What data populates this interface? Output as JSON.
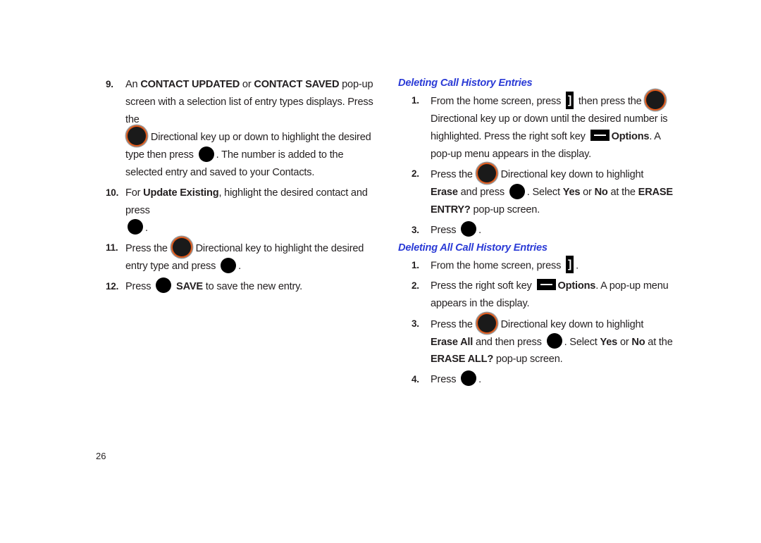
{
  "page_number": "26",
  "icons": {
    "directional_key": "directional-key-icon",
    "ok_key": "ok-key-icon",
    "end_key": "end-key-icon",
    "right_soft_key": "right-soft-key-icon"
  },
  "colors": {
    "heading": "#2b3bd6",
    "dpad_ring": "#e05a1c",
    "text": "#231f20"
  },
  "left_steps": [
    {
      "num": "9.",
      "t1": "An ",
      "b1": "CONTACT UPDATED",
      "t2": " or ",
      "b2": "CONTACT SAVED",
      "t3": " pop-up screen with a selection list of entry types displays. Press the",
      "t4": " Directional key up or down to highlight the desired type then press",
      "t5": ". The number is added to the selected entry and saved to your Contacts."
    },
    {
      "num": "10.",
      "t1": "For ",
      "b1": "Update Existing",
      "t2": ", highlight the desired contact and press",
      "t3": "."
    },
    {
      "num": "11.",
      "t1": "Press the",
      "t2": " Directional key to highlight the desired entry type and press",
      "t3": "."
    },
    {
      "num": "12.",
      "t1": "Press",
      "b1": "SAVE",
      "t2": " to save the new entry."
    }
  ],
  "sections": [
    {
      "heading": "Deleting Call History Entries",
      "steps": [
        {
          "num": "1.",
          "t1": "From the home screen, press",
          "t2": " then press the",
          "t3": " Directional key up or down until the desired number is highlighted. Press the right soft key",
          "b1": "Options",
          "t4": ". A pop-up menu appears in the display."
        },
        {
          "num": "2.",
          "t1": "Press the",
          "t2": " Directional key down to highlight ",
          "b1": "Erase",
          "t3": " and press",
          "t4": ". Select ",
          "b2": "Yes",
          "t5": " or ",
          "b3": "No",
          "t6": " at the ",
          "b4": "ERASE ENTRY?",
          "t7": " pop-up screen."
        },
        {
          "num": "3.",
          "t1": "Press",
          "t2": "."
        }
      ]
    },
    {
      "heading": "Deleting All Call History Entries",
      "steps": [
        {
          "num": "1.",
          "t1": "From the home screen, press",
          "t2": "."
        },
        {
          "num": "2.",
          "t1": "Press the right soft key",
          "b1": "Options",
          "t2": ". A pop-up menu appears in the display."
        },
        {
          "num": "3.",
          "t1": "Press the",
          "t2": " Directional key down to highlight ",
          "b1": "Erase All",
          "t3": " and then press",
          "t4": ". Select ",
          "b2": "Yes",
          "t5": " or ",
          "b3": "No",
          "t6": " at the ",
          "b4": "ERASE ALL?",
          "t7": " pop-up screen."
        },
        {
          "num": "4.",
          "t1": "Press",
          "t2": "."
        }
      ]
    }
  ]
}
